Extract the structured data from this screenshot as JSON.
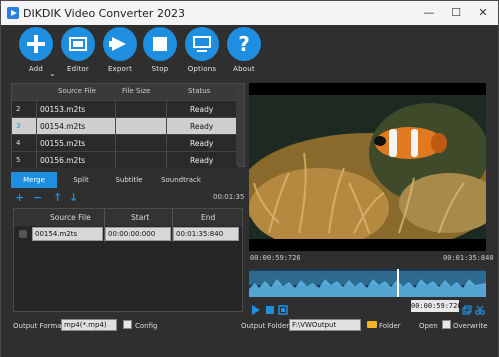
{
  "window": {
    "title": "DIKDIK Video Converter 2023",
    "controls": [
      "—",
      "☐",
      "✕"
    ]
  },
  "toolbar": {
    "items": [
      {
        "label": "Add",
        "icon": "plus-icon"
      },
      {
        "label": "Editor",
        "icon": "film-icon"
      },
      {
        "label": "Export",
        "icon": "arrow-right-icon"
      },
      {
        "label": "Stop",
        "icon": "stop-icon"
      },
      {
        "label": "Options",
        "icon": "monitor-icon"
      },
      {
        "label": "About",
        "icon": "question-icon"
      }
    ],
    "add_dropdown": "⌄"
  },
  "file_table": {
    "columns": [
      "Source File",
      "File Size",
      "Status"
    ],
    "rows": [
      {
        "num": "2",
        "name": "00153.m2ts",
        "size": "",
        "status": "Ready"
      },
      {
        "num": "3",
        "name": "00154.m2ts",
        "size": "",
        "status": "Ready"
      },
      {
        "num": "4",
        "name": "00155.m2ts",
        "size": "",
        "status": "Ready"
      },
      {
        "num": "5",
        "name": "00156.m2ts",
        "size": "",
        "status": "Ready"
      }
    ]
  },
  "tabs": [
    "Merge",
    "Split",
    "Subtitle",
    "Soundtrack"
  ],
  "actions": {
    "add": "+",
    "remove": "−",
    "up": "↑",
    "down": "↓"
  },
  "merge_duration": "00:01:35",
  "segments": {
    "columns": [
      "Source File",
      "Start",
      "End"
    ],
    "rows": [
      {
        "name": "00154.m2ts",
        "start": "00:00:00:000",
        "end": "00:01:35:840"
      }
    ]
  },
  "player": {
    "current_time": "00:00:59:726",
    "end_time": "00:01:35:840",
    "position_box": "00:00:59:726"
  },
  "bottom": {
    "output_format_label": "Output Format",
    "output_format_value": "mp4(*.mp4)",
    "config_label": "Config",
    "output_folder_label": "Output Folder",
    "output_folder_value": "F:\\VWOutput",
    "folder_label": "Folder",
    "open_label": "Open",
    "overwrite_label": "Overwrite"
  },
  "colors": {
    "accent": "#1e8fe0",
    "background": "#2f2f2f"
  }
}
